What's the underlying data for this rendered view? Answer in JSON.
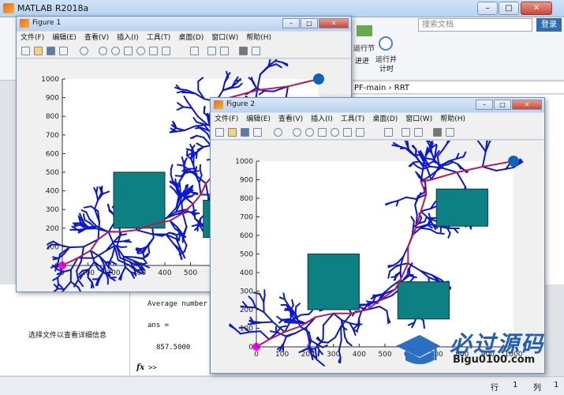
{
  "matlab": {
    "title": "MATLAB R2018a",
    "search_placeholder": "搜索文档",
    "login": "登录",
    "ribbon": {
      "run_section": "运行节",
      "advance": "进进",
      "run_and_time_line1": "运行并",
      "run_and_time_line2": "计时"
    },
    "address": {
      "folder": "PF-main",
      "sep": "›",
      "sub": "RRT"
    },
    "left_hint": "选择文件以查看详细信息",
    "command": {
      "line1": "Average number",
      "line2": "ans =",
      "line3": "857.5000",
      "prompt": ">>",
      "fx": "fx"
    },
    "status": {
      "row_label": "行",
      "row": "1",
      "col_label": "列",
      "col": "1"
    }
  },
  "watermark": {
    "text": "必过源码",
    "url": "Bigu0100.com"
  },
  "menu_items": [
    "文件(F)",
    "编辑(E)",
    "查看(V)",
    "插入(I)",
    "工具(T)",
    "桌面(D)",
    "窗口(W)",
    "帮助(H)"
  ],
  "figure1": {
    "title": "Figure 1"
  },
  "figure2": {
    "title": "Figure 2"
  },
  "colors": {
    "tree": "#0a17d6",
    "path": "#c0154e",
    "obstacle": "#0c8082",
    "start": "#ff00ff",
    "goal": "#1163b8"
  },
  "chart_data": [
    {
      "type": "scatter",
      "title": "",
      "xlabel": "",
      "ylabel": "",
      "xlim": [
        0,
        1000
      ],
      "ylim": [
        0,
        1000
      ],
      "xticks": [
        0,
        100,
        200,
        300,
        400,
        500
      ],
      "yticks": [
        0,
        100,
        200,
        300,
        400,
        500,
        600,
        700,
        800,
        900,
        1000
      ],
      "start": [
        0,
        0
      ],
      "goal": [
        1000,
        1000
      ],
      "obstacles": [
        [
          200,
          200,
          200,
          300
        ],
        [
          550,
          150,
          200,
          200
        ]
      ],
      "path": [
        [
          0,
          0
        ],
        [
          60,
          40
        ],
        [
          110,
          80
        ],
        [
          140,
          140
        ],
        [
          180,
          180
        ],
        [
          230,
          180
        ],
        [
          290,
          190
        ],
        [
          350,
          220
        ],
        [
          420,
          240
        ],
        [
          470,
          280
        ],
        [
          510,
          330
        ],
        [
          540,
          380
        ],
        [
          560,
          440
        ],
        [
          600,
          500
        ],
        [
          640,
          560
        ],
        [
          650,
          640
        ],
        [
          620,
          700
        ],
        [
          620,
          740
        ],
        [
          600,
          880
        ],
        [
          760,
          940
        ],
        [
          880,
          960
        ],
        [
          1000,
          1000
        ]
      ]
    },
    {
      "type": "scatter",
      "title": "",
      "xlabel": "",
      "ylabel": "",
      "xlim": [
        0,
        1000
      ],
      "ylim": [
        0,
        1000
      ],
      "xticks": [
        0,
        100,
        200,
        300,
        400,
        500,
        600,
        700,
        800,
        900,
        1000
      ],
      "yticks": [
        0,
        100,
        200,
        300,
        400,
        500,
        600,
        700,
        800,
        900,
        1000
      ],
      "start": [
        0,
        0
      ],
      "goal": [
        1000,
        1000
      ],
      "obstacles": [
        [
          200,
          200,
          200,
          300
        ],
        [
          550,
          150,
          200,
          200
        ],
        [
          700,
          650,
          200,
          200
        ]
      ],
      "path": [
        [
          0,
          0
        ],
        [
          50,
          40
        ],
        [
          110,
          80
        ],
        [
          170,
          110
        ],
        [
          230,
          160
        ],
        [
          300,
          180
        ],
        [
          370,
          180
        ],
        [
          430,
          200
        ],
        [
          480,
          250
        ],
        [
          540,
          310
        ],
        [
          560,
          360
        ],
        [
          590,
          450
        ],
        [
          590,
          540
        ],
        [
          620,
          640
        ],
        [
          640,
          730
        ],
        [
          660,
          820
        ],
        [
          640,
          890
        ],
        [
          680,
          900
        ],
        [
          780,
          940
        ],
        [
          880,
          970
        ],
        [
          1000,
          1000
        ]
      ]
    }
  ]
}
